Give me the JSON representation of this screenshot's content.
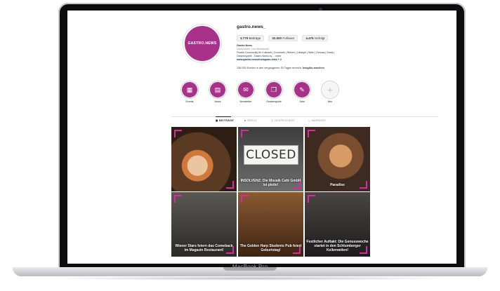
{
  "device": {
    "brand": "MacBook Pro"
  },
  "profile": {
    "avatar_text": "GASTRO.NEWS",
    "avatar_sub": "",
    "username": "gastro.news_",
    "stats": [
      {
        "value": "3.779",
        "label": "Beiträge"
      },
      {
        "value": "32.500",
        "label": "Follower"
      },
      {
        "value": "4.476",
        "label": "Gefolgt"
      }
    ],
    "bio_name": "Gastro.News",
    "bio_category": "Nachrichten- und Mediaseite",
    "bio_line1": "Foodie Community für Kulinarik | Gourmets | Reisen | Lifestyle | Wein | Genuss | Deals |",
    "bio_line2": "Gewinnspiele - Gastro.News by ... mehr",
    "bio_link": "www.gastro.news/instagram-links + 2",
    "insight_text": "136.000 Konten in den vergangenen 30 Tagen erreicht.",
    "insight_link": "Insights ansehen"
  },
  "highlights": [
    {
      "label": "Events",
      "icon": "calendar-icon"
    },
    {
      "label": "News",
      "icon": "newspaper-icon"
    },
    {
      "label": "Newsletter",
      "icon": "mail-icon"
    },
    {
      "label": "Gewinnspiele",
      "icon": "gift-icon"
    },
    {
      "label": "Jobs",
      "icon": "tag-icon"
    },
    {
      "label": "Neu",
      "icon": "plus-icon"
    }
  ],
  "tabs": [
    {
      "label": "BEITRÄGE",
      "active": true
    },
    {
      "label": "REELS",
      "active": false
    },
    {
      "label": "GESPEICHERT",
      "active": false
    },
    {
      "label": "MARKIERT",
      "active": false
    }
  ],
  "posts": [
    {
      "caption": "",
      "bg": "#6b4a36"
    },
    {
      "caption": "INSOLVENZ: Die Mozaik Café GmbH ist pleite!",
      "sign": "CLOSED",
      "bg": "#4b4b4b"
    },
    {
      "caption": "Paradise",
      "bg": "#8a6b55"
    },
    {
      "caption": "Wiener Stars feiern das Comeback im Magazin Restaurant!",
      "bg": "#3b3a38"
    },
    {
      "caption": "The Golden Harp Students Pub feiert Geburtstag!",
      "bg": "#5e3c22"
    },
    {
      "caption": "Festlicher Auftakt: Die Genusswoche startet in den Schlumberger Kellerwelten!",
      "bg": "#2c2a2a"
    }
  ],
  "colors": {
    "brand": "#a8328a",
    "accent": "#d82aa3"
  }
}
